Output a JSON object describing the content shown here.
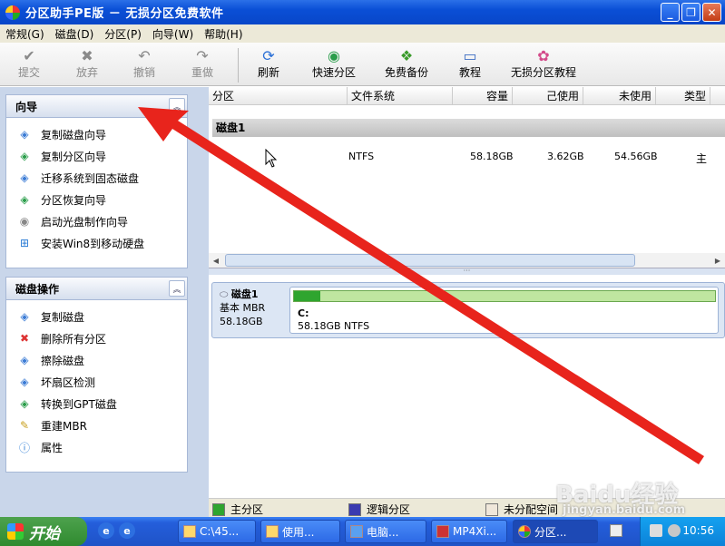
{
  "window": {
    "title": "分区助手PE版 － 无损分区免费软件",
    "min": "_",
    "max": "❐",
    "close": "✕"
  },
  "menu": [
    "常规(G)",
    "磁盘(D)",
    "分区(P)",
    "向导(W)",
    "帮助(H)"
  ],
  "toolbar": {
    "commit": "提交",
    "discard": "放弃",
    "undo": "撤销",
    "redo": "重做",
    "refresh": "刷新",
    "quick_partition": "快速分区",
    "free_backup": "免费备份",
    "tutorial": "教程",
    "lossless_tutorial": "无损分区教程"
  },
  "wizard_group": {
    "title": "向导",
    "items": [
      "复制磁盘向导",
      "复制分区向导",
      "迁移系统到固态磁盘",
      "分区恢复向导",
      "启动光盘制作向导",
      "安装Win8到移动硬盘"
    ]
  },
  "disk_ops_group": {
    "title": "磁盘操作",
    "items": [
      "复制磁盘",
      "删除所有分区",
      "擦除磁盘",
      "坏扇区检测",
      "转换到GPT磁盘",
      "重建MBR",
      "属性"
    ]
  },
  "table": {
    "headers": [
      "分区",
      "文件系统",
      "容量",
      "己使用",
      "未使用",
      "类型"
    ],
    "disk_label": "磁盘1",
    "row": {
      "fs": "NTFS",
      "capacity": "58.18GB",
      "used": "3.62GB",
      "unused": "54.56GB",
      "type": "主"
    }
  },
  "diskmap": {
    "name": "磁盘1",
    "type": "基本 MBR",
    "size": "58.18GB",
    "partition_name": "C:",
    "partition_info": "58.18GB NTFS",
    "used_fraction": 0.062
  },
  "legend": {
    "primary": "主分区",
    "logical": "逻辑分区",
    "unallocated": "未分配空间"
  },
  "colors": {
    "primary": "#2fa52f",
    "logical": "#3b3bb0",
    "unallocated": "#efe7da",
    "arrow": "#e8241c"
  },
  "taskbar": {
    "start": "开始",
    "tasks": [
      "C:\\45...",
      "使用...",
      "电脑...",
      "MP4Xi...",
      "分区..."
    ],
    "clock": "10:56"
  },
  "watermark": {
    "logo": "Baidu经验",
    "url": "jingyan.baidu.com"
  }
}
